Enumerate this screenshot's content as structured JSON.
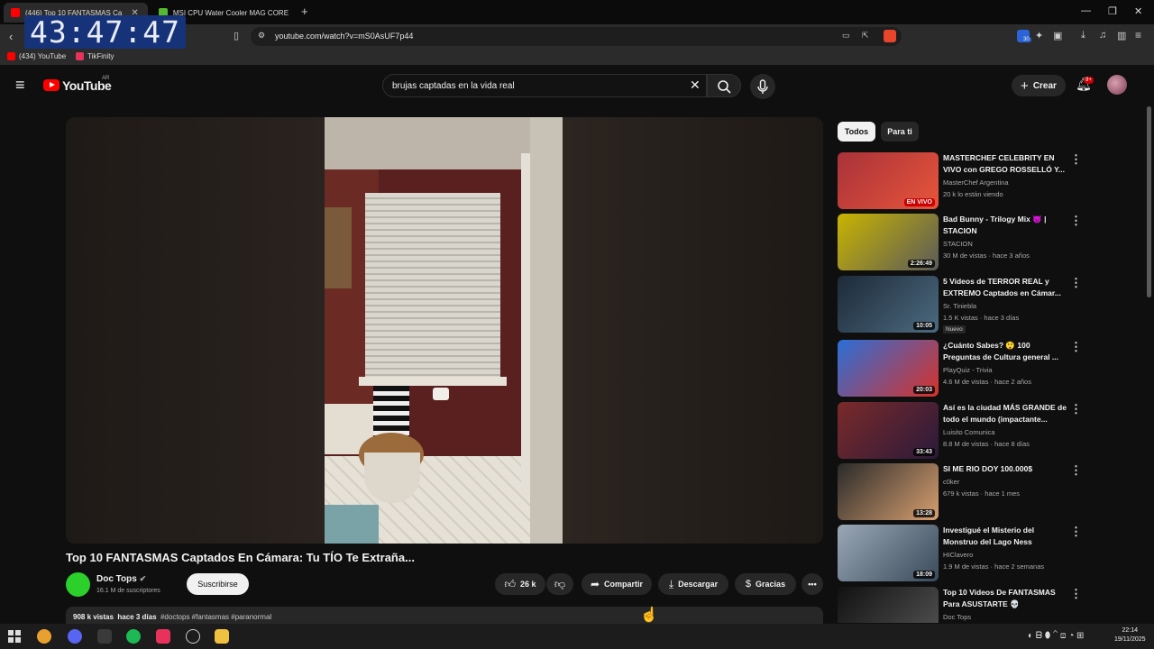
{
  "browser": {
    "tabs": [
      {
        "label": "(446) Top 10 FANTASMAS Ca",
        "color": "#ff0000"
      },
      {
        "label": "MSI CPU Water Cooler MAG CORELIG",
        "color": "#55b82e"
      }
    ],
    "new_tab": "+",
    "window_controls": {
      "minimize": "—",
      "restore": "❐",
      "close": "✕"
    },
    "url": "youtube.com/watch?v=mS0AsUF7p44",
    "bookmarks": [
      {
        "label": "(434) YouTube",
        "color": "#ff0000"
      },
      {
        "label": "TikFinity",
        "color": "#e8325b"
      }
    ],
    "extension_badge": "30"
  },
  "overlay_clock": "43:47:47",
  "youtube": {
    "logo_text": "YouTube",
    "country_code": "AR",
    "search_value": "brujas captadas en la vida real",
    "create_label": "Crear",
    "notifications_badge": "9+"
  },
  "video": {
    "title": "Top 10 FANTASMAS Captados En Cámara: Tu TÍO Te Extraña...",
    "channel": "Doc Tops",
    "subscribers": "16.1 M de suscriptores",
    "subscribe_label": "Suscribirse",
    "likes": "26 k",
    "share_label": "Compartir",
    "download_label": "Descargar",
    "thanks_label": "Gracias",
    "views": "908 k vistas",
    "age": "hace 3 días",
    "tags": "#doctops #fantasmas #paranormal"
  },
  "sidebar": {
    "chips": [
      "Todos",
      "Para ti"
    ],
    "recommendations": [
      {
        "title": "MASTERCHEF CELEBRITY EN VIVO con GREGO ROSSELLÓ Y...",
        "channel": "MasterChef Argentina",
        "meta": "20 k lo están viendo",
        "live": "EN VIVO",
        "thumb": "#a8323a"
      },
      {
        "title": "Bad Bunny - Trilogy Mix 😈 | STACION",
        "channel": "STACION",
        "meta": "30 M de vistas · hace 3 años",
        "duration": "2:26:49",
        "thumb": "#c9b400"
      },
      {
        "title": "5 Videos de TERROR REAL y EXTREMO Captados en Cámar...",
        "channel": "Sr. Tinieblа",
        "meta": "1.5 K vistas · hace 3 días",
        "duration": "10:05",
        "badge": "Nuevo",
        "thumb": "#3a4a5a"
      },
      {
        "title": "¿Cuánto Sabes? 😲 100 Preguntas de Cultura general ...",
        "channel": "PlayQuiz - Trivia",
        "meta": "4.6 M de vistas · hace 2 años",
        "duration": "20:03",
        "thumb": "#2a6fd8"
      },
      {
        "title": "Así es la ciudad MÁS GRANDE de todo el mundo (impactante...",
        "channel": "Luisito Comunica",
        "meta": "8.8 M de vistas · hace 8 días",
        "duration": "33:43",
        "thumb": "#7a2a2a"
      },
      {
        "title": "SI ME RIO DOY 100.000$",
        "channel": "c0ker",
        "meta": "679 k vistas · hace 1 mes",
        "duration": "13:28",
        "thumb": "#2a2a2a"
      },
      {
        "title": "Investigué el Misterio del Monstruo del Lago Ness",
        "channel": "HIClavero",
        "meta": "1.9 M de vistas · hace 2 semanas",
        "duration": "18:09",
        "thumb": "#6a7a8a"
      },
      {
        "title": "Top 10 Videos De FANTASMAS Para ASUSTARTE 💀",
        "channel": "Doc Tops",
        "meta": "",
        "duration": "",
        "thumb": "#1a1a1a"
      }
    ]
  },
  "taskbar": {
    "time": "22:14",
    "date": "19/11/2025"
  }
}
